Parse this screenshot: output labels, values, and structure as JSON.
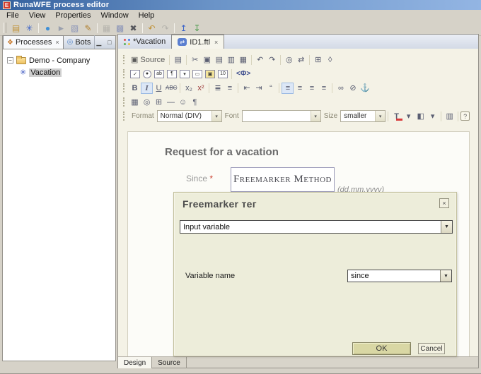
{
  "window": {
    "title": "RunaWFE process editor",
    "app_glyph": "E"
  },
  "menu": {
    "items": [
      "File",
      "View",
      "Properties",
      "Window",
      "Help"
    ]
  },
  "toolbar": {
    "new_wizard": "▤",
    "new_process": "✳",
    "bot_station": "●",
    "pointer": "►",
    "stamp": "▧",
    "script": "✎",
    "save": "▦",
    "save_all": "▩",
    "delete": "✖",
    "undo": "↶",
    "redo": "↷",
    "deploy": "↥",
    "export": "↧"
  },
  "left_panel": {
    "tab_processes": "Processes",
    "tab_bots": "Bots",
    "close_glyph": "×",
    "processes_icon": "❖",
    "bots_icon": "◎",
    "minimize_glyph": "▁",
    "maximize_glyph": "□",
    "tree": {
      "expander": "−",
      "root_label": "Demo - Company",
      "child_label": "Vacation",
      "child_icon": "✳"
    }
  },
  "editor": {
    "tab_vacation": "*Vacation",
    "tab_ftl": "ID1.ftl",
    "tab_close": "×",
    "ftl_glyph": "⇄",
    "toolbar1": {
      "source_icon": "▣",
      "source_label": "Source",
      "new_page": "▤",
      "cut": "✂",
      "copy": "▣",
      "paste": "▤",
      "paste_text": "▥",
      "paste_word": "▦",
      "undo": "↶",
      "redo": "↷",
      "find": "◎",
      "replace": "⇄",
      "select_all": "⊞",
      "eraser": "◊"
    },
    "toolbar2": {
      "checkbox": "✓",
      "radio": "●",
      "text_field": "ab",
      "textarea": "¶",
      "select_field": "▾",
      "button": "▭",
      "image_button": "▣",
      "hidden_field": "10",
      "freemarker_tag": "<Ф>"
    },
    "toolbar3": {
      "bold": "B",
      "italic": "I",
      "underline": "U",
      "strike": "ABC",
      "subscript": "x₂",
      "superscript": "x²",
      "ordered_list": "≣",
      "unordered_list": "≡",
      "outdent": "⇤",
      "indent": "⇥",
      "blockquote": "“",
      "align_left": "≡",
      "align_center": "≡",
      "align_right": "≡",
      "align_justify": "≡",
      "link": "∞",
      "unlink": "⊘",
      "anchor": "⚓"
    },
    "toolbar4": {
      "image": "▦",
      "flash": "◎",
      "table": "⊞",
      "horizontal_rule": "―",
      "smiley": "☺",
      "page_break": "¶"
    },
    "toolbar5": {
      "format_label": "Format",
      "format_value": "Normal (DIV)",
      "font_label": "Font",
      "font_value": "",
      "size_label": "Size",
      "size_value": "smaller",
      "text_color": "T",
      "bg_color": "◧",
      "dropdown_arrow": "▾",
      "preview": "▥",
      "help": "?"
    },
    "canvas": {
      "heading": "Request for a vacation",
      "since_label": "Since",
      "required_mark": "*",
      "field_text": "Freemarker Method",
      "date_hint": "(dd.mm.yyyy)"
    },
    "bottom_tabs": {
      "design": "Design",
      "source": "Source"
    }
  },
  "dialog": {
    "title": "Freemarker тег",
    "close_glyph": "×",
    "type_value": "Input variable",
    "variable_label": "Variable name",
    "variable_value": "since",
    "ok_label": "OK",
    "cancel_label": "Cancel",
    "arrow_glyph": "▼"
  },
  "colors": {
    "titlebar_start": "#35619e",
    "titlebar_end": "#93b5e3",
    "window_chrome": "#d6d2c8",
    "editor_bg": "#f4f2e6",
    "dialog_bg": "#ededda",
    "ok_button_bg": "#d9d7a4",
    "toggle_highlight": "#dce7f6",
    "required_red": "#cc4433"
  }
}
